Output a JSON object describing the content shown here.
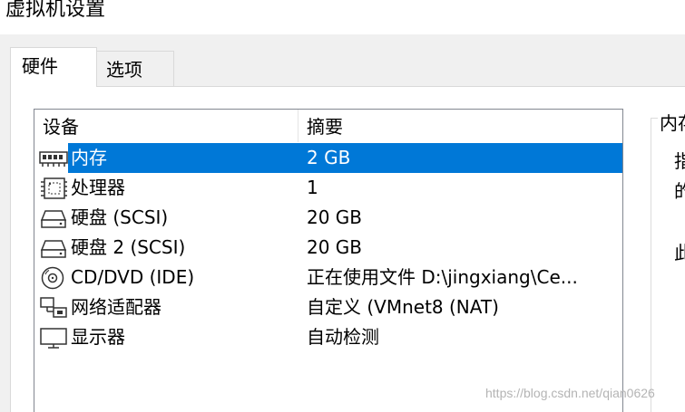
{
  "window": {
    "title": "虚拟机设置"
  },
  "tabs": [
    {
      "label": "硬件",
      "active": true
    },
    {
      "label": "选项",
      "active": false
    }
  ],
  "device_list": {
    "columns": [
      "设备",
      "摘要"
    ],
    "rows": [
      {
        "icon": "memory-icon",
        "device": "内存",
        "summary": "2 GB",
        "selected": true
      },
      {
        "icon": "cpu-icon",
        "device": "处理器",
        "summary": "1",
        "selected": false
      },
      {
        "icon": "harddisk-icon",
        "device": "硬盘 (SCSI)",
        "summary": "20 GB",
        "selected": false
      },
      {
        "icon": "harddisk-icon",
        "device": "硬盘 2 (SCSI)",
        "summary": "20 GB",
        "selected": false
      },
      {
        "icon": "cd-dvd-icon",
        "device": "CD/DVD (IDE)",
        "summary": "正在使用文件 D:\\jingxiang\\Ce...",
        "selected": false
      },
      {
        "icon": "network-adapter-icon",
        "device": "网络适配器",
        "summary": "自定义 (VMnet8 (NAT)",
        "selected": false
      },
      {
        "icon": "display-icon",
        "device": "显示器",
        "summary": "自动检测",
        "selected": false
      }
    ]
  },
  "right_panel": {
    "caption": "内存",
    "line1": "指",
    "line2": "的",
    "line3": "此"
  },
  "watermark": "https://blog.csdn.net/qian0626",
  "colors": {
    "selection": "#0078d7",
    "background": "#f0f0f0"
  }
}
